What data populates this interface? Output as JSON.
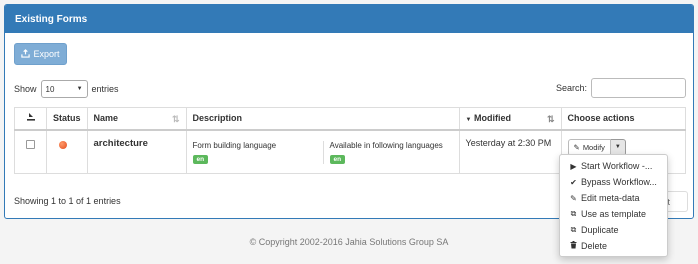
{
  "panel": {
    "title": "Existing Forms"
  },
  "toolbar": {
    "export_label": "Export",
    "export_icon": "export-icon"
  },
  "length": {
    "show_label": "Show",
    "value": "10",
    "entries_label": "entries"
  },
  "search": {
    "label": "Search:",
    "value": "",
    "placeholder": ""
  },
  "table": {
    "headers": {
      "status": "Status",
      "name": "Name",
      "description": "Description",
      "modified": "Modified",
      "actions": "Choose actions"
    },
    "rows": [
      {
        "status_color": "#e34b1c",
        "name": "architecture",
        "desc_language_label": "Form building language",
        "desc_language_badge": "en",
        "desc_available_label": "Available in following languages",
        "desc_available_badge": "en",
        "modified": "Yesterday at 2:30 PM",
        "modify_label": "Modify"
      }
    ]
  },
  "actions_menu": {
    "items": [
      {
        "label": "Start Workflow -...",
        "icon": "play-icon"
      },
      {
        "label": "Bypass Workflow...",
        "icon": "check-icon"
      },
      {
        "label": "Edit meta-data",
        "icon": "pencil-icon"
      },
      {
        "label": "Use as template",
        "icon": "copy-icon"
      },
      {
        "label": "Duplicate",
        "icon": "copy-icon"
      },
      {
        "label": "Delete",
        "icon": "trash-icon"
      }
    ]
  },
  "info": {
    "text": "Showing 1 to 1 of 1 entries"
  },
  "pagination": {
    "next_label": "xt"
  },
  "footer": {
    "copyright": "© Copyright 2002-2016 Jahia Solutions Group SA"
  },
  "colors": {
    "primary": "#337ab7",
    "success": "#5cb85c",
    "status_red": "#e34b1c"
  }
}
